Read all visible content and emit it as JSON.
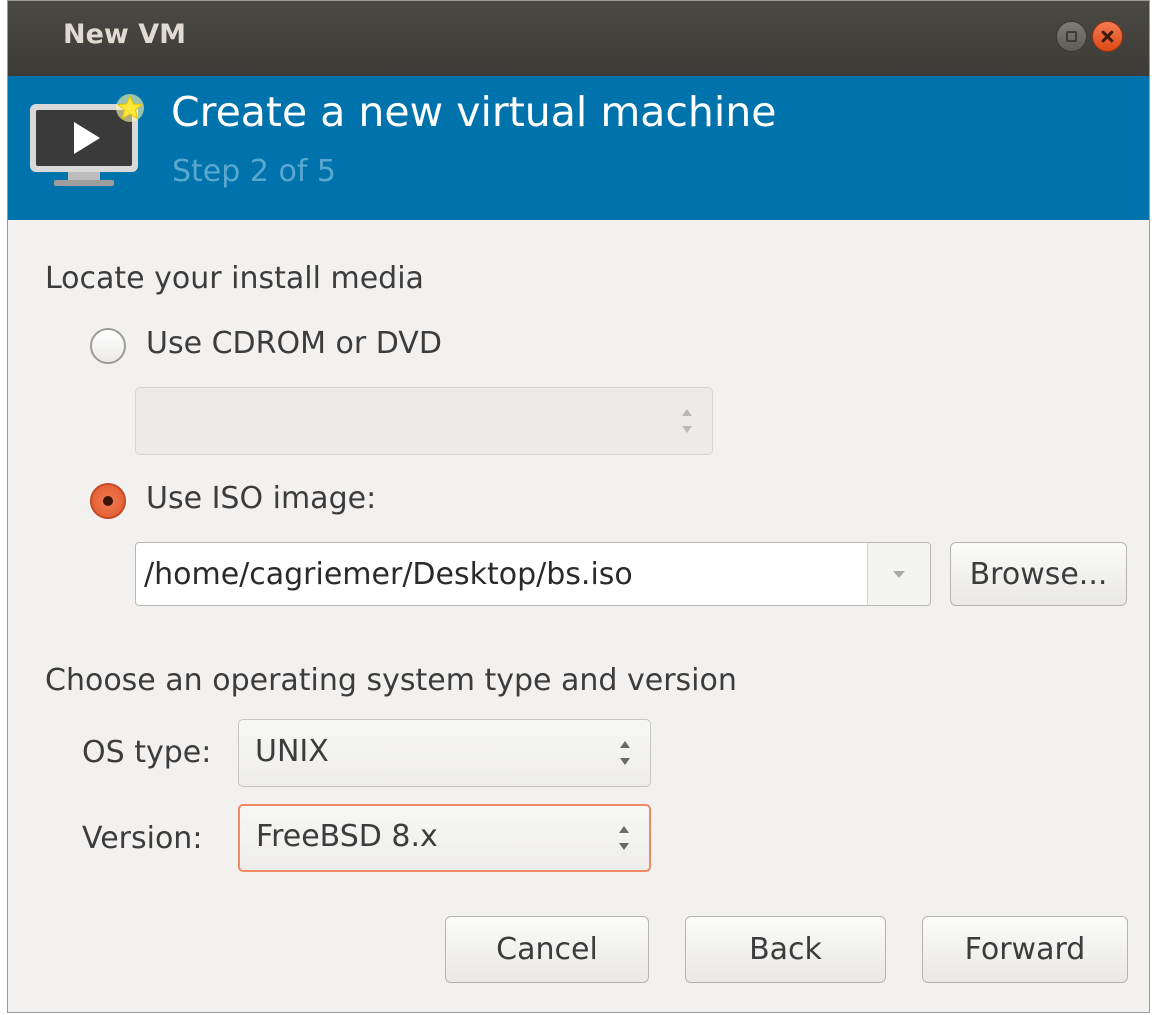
{
  "window": {
    "title": "New VM"
  },
  "header": {
    "title": "Create a new virtual machine",
    "step": "Step 2 of 5",
    "icon": "vm-monitor-new-icon"
  },
  "install_media": {
    "section_label": "Locate your install media",
    "cdrom_option": {
      "label": "Use CDROM or DVD",
      "selected": false
    },
    "cdrom_select": {
      "value": "",
      "enabled": false
    },
    "iso_option": {
      "label": "Use ISO image:",
      "selected": true
    },
    "iso_path": "/home/cagriemer/Desktop/bs.iso",
    "browse_label": "Browse..."
  },
  "os": {
    "section_label": "Choose an operating system type and version",
    "type_label": "OS type:",
    "type_value": "UNIX",
    "version_label": "Version:",
    "version_value": "FreeBSD 8.x"
  },
  "buttons": {
    "cancel": "Cancel",
    "back": "Back",
    "forward": "Forward"
  },
  "colors": {
    "header_bg": "#0072ac",
    "accent": "#e05a2e",
    "titlebar_bg": "#3c3b37"
  }
}
